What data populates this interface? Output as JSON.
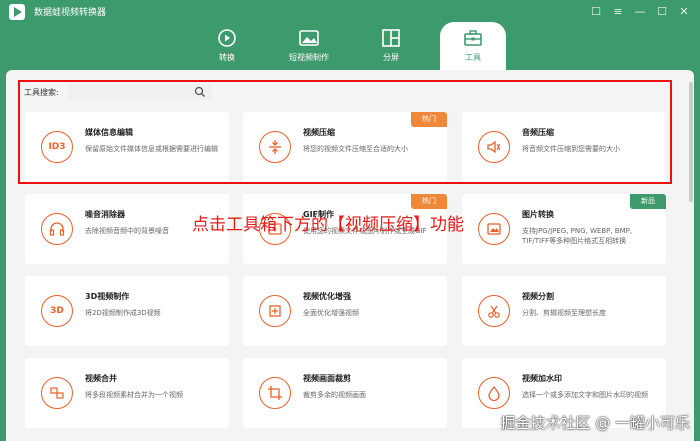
{
  "app": {
    "title": "数据蛙视频转换器"
  },
  "window_controls": {
    "feedback": "☐",
    "menu": "≡",
    "minimize": "—",
    "maximize": "☐",
    "close": "✕"
  },
  "nav": {
    "tabs": [
      {
        "label": "转换",
        "icon": "convert-icon"
      },
      {
        "label": "短视频制作",
        "icon": "image-icon"
      },
      {
        "label": "分屏",
        "icon": "split-screen-icon"
      },
      {
        "label": "工具",
        "icon": "toolbox-icon"
      }
    ],
    "active": "工具"
  },
  "search": {
    "label": "工具搜索:",
    "placeholder": ""
  },
  "tools": [
    {
      "title": "媒体信息编辑",
      "desc": "保留原始文件媒体信息或根据需要进行编辑",
      "icon": "ID3",
      "badge": ""
    },
    {
      "title": "视频压缩",
      "desc": "将您的视频文件压缩至合适的大小",
      "icon": "compress-icon",
      "badge": "热门"
    },
    {
      "title": "音频压缩",
      "desc": "将音频文件压缩到您需要的大小",
      "icon": "audio-compress-icon",
      "badge": ""
    },
    {
      "title": "噪音消除器",
      "desc": "去除视频音频中的背景噪音",
      "icon": "headphones-icon",
      "badge": ""
    },
    {
      "title": "GIF制作",
      "desc": "使用您的视频文件或图片制作或生成GIF",
      "icon": "gif-icon",
      "badge": "热门"
    },
    {
      "title": "图片转换",
      "desc": "支持JPG/JPEG, PNG, WEBP, BMP, TIF/TIFF等多种图片格式互相转换",
      "icon": "image-convert-icon",
      "badge": "新品"
    },
    {
      "title": "3D视频制作",
      "desc": "将2D视频制作成3D视频",
      "icon": "3D",
      "badge": ""
    },
    {
      "title": "视频优化增强",
      "desc": "全面优化增强视频",
      "icon": "enhance-icon",
      "badge": ""
    },
    {
      "title": "视频分割",
      "desc": "分割、剪辑视频至理想长度",
      "icon": "scissors-icon",
      "badge": ""
    },
    {
      "title": "视频合并",
      "desc": "将多段视频素材合并为一个视频",
      "icon": "merge-icon",
      "badge": ""
    },
    {
      "title": "视频画面裁剪",
      "desc": "裁剪多余的视频画面",
      "icon": "crop-icon",
      "badge": ""
    },
    {
      "title": "视频加水印",
      "desc": "选择一个或多添加文字和图片水印的视频",
      "icon": "watermark-drop-icon",
      "badge": ""
    }
  ],
  "annotation": {
    "text": "点击工具箱下方的【视频压缩】功能"
  },
  "watermark": {
    "text": "掘金技术社区 @ 一罐小可乐"
  },
  "colors": {
    "brand": "#3d9a6c",
    "accent": "#e8622a",
    "hot": "#f0883a",
    "highlight": "#e11111"
  }
}
